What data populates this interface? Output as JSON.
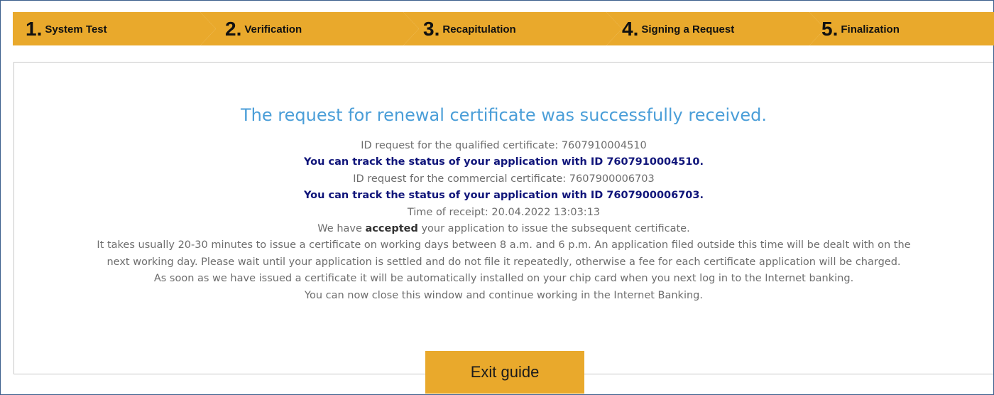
{
  "wizard": {
    "steps": [
      {
        "number": "1.",
        "label": "System Test"
      },
      {
        "number": "2.",
        "label": "Verification"
      },
      {
        "number": "3.",
        "label": "Recapitulation"
      },
      {
        "number": "4.",
        "label": "Signing a Request"
      },
      {
        "number": "5.",
        "label": "Finalization"
      }
    ],
    "accent_color": "#e9a92c"
  },
  "result": {
    "title": "The request for renewal certificate was successfully received.",
    "qualified_id_line": "ID request for the qualified certificate: 7607910004510",
    "qualified_track_line": "You can track the status of your application with ID 7607910004510.",
    "commercial_id_line": "ID request for the commercial certificate: 7607900006703",
    "commercial_track_line": "You can track the status of your application with ID 7607900006703.",
    "receipt_line": "Time of receipt: 20.04.2022 13:03:13",
    "accepted_prefix": "We have ",
    "accepted_word": "accepted",
    "accepted_suffix": " your application to issue the subsequent certificate.",
    "info_line_1": "It takes usually 20-30 minutes to issue a certificate on working days between 8 a.m. and 6 p.m. An application filed outside this time will be dealt with on the",
    "info_line_2": "next working day. Please wait until your application is settled and do not file it repeatedly, otherwise a fee for each certificate application will be charged.",
    "info_line_3": "As soon as we have issued a certificate it will be automatically installed on your chip card when you next log in to the Internet banking.",
    "info_line_4": "You can now close this window and continue working in the Internet Banking."
  },
  "actions": {
    "exit_label": "Exit guide"
  }
}
